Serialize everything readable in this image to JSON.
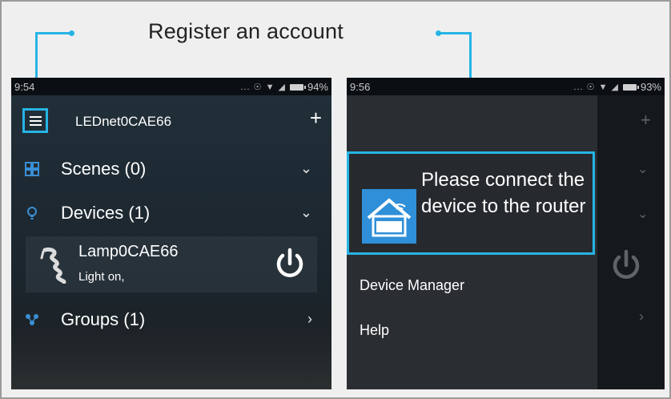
{
  "caption": "Register an account",
  "left_screen": {
    "status": {
      "time": "9:54",
      "icons": "... ☉ ▼ ◢",
      "battery": "94%"
    },
    "header": {
      "menu_icon": "hamburger-menu-icon",
      "title": "LEDnet0CAE66",
      "add_icon": "+"
    },
    "sections": [
      {
        "label": "Scenes (0)",
        "icon": "grid-icon",
        "chevron": "⌄"
      },
      {
        "label": "Devices (1)",
        "icon": "bulb-icon",
        "chevron": "⌄"
      },
      {
        "label": "Groups (1)",
        "icon": "groups-icon",
        "chevron": "›"
      }
    ],
    "device": {
      "name": "Lamp0CAE66",
      "status": "Light on,",
      "icon": "lamp-icon",
      "power_icon": "power-icon"
    }
  },
  "right_screen": {
    "status": {
      "time": "9:56",
      "icons": "... ☉ ▼ ◢",
      "battery": "93%"
    },
    "message": "Please connect the device to the router",
    "logo_icon": "magic-home-logo",
    "menu": [
      "Device Manager",
      "Help"
    ]
  },
  "colors": {
    "accent": "#26b4e5",
    "phone_bg": "#1d262d",
    "drawer_bg": "#2a2e32"
  }
}
